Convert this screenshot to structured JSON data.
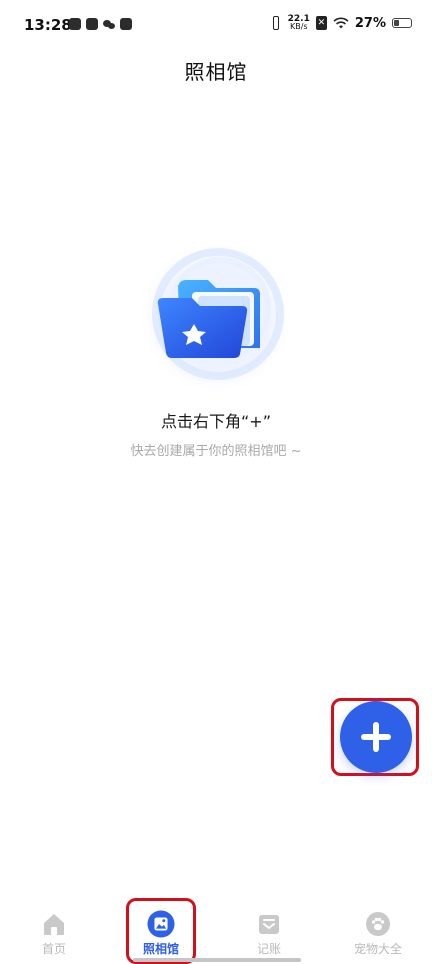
{
  "status_bar": {
    "time": "13:28",
    "net_speed_value": "22.1",
    "net_speed_unit": "KB/s",
    "battery_percent": "27%",
    "icons": [
      "video-app-icon",
      "mail-app-icon",
      "wechat-icon",
      "message-app-icon",
      "vibrate-icon",
      "no-sim-icon",
      "wifi-icon",
      "battery-icon"
    ]
  },
  "header": {
    "title": "照相馆"
  },
  "empty_state": {
    "title": "点击右下角“+”",
    "subtitle": "快去创建属于你的照相馆吧 ~",
    "icon": "folder-illustration"
  },
  "fab": {
    "icon": "plus-icon",
    "color": "#2e60e8"
  },
  "bottom_nav": {
    "items": [
      {
        "label": "首页",
        "icon": "home-icon",
        "active": false
      },
      {
        "label": "照相馆",
        "icon": "photo-gallery-icon",
        "active": true
      },
      {
        "label": "记账",
        "icon": "ledger-icon",
        "active": false
      },
      {
        "label": "宠物大全",
        "icon": "paw-icon",
        "active": false
      }
    ]
  },
  "colors": {
    "accent": "#2e60e8",
    "highlight_box": "#d40f1c",
    "inactive_nav": "#b9b9b9"
  }
}
